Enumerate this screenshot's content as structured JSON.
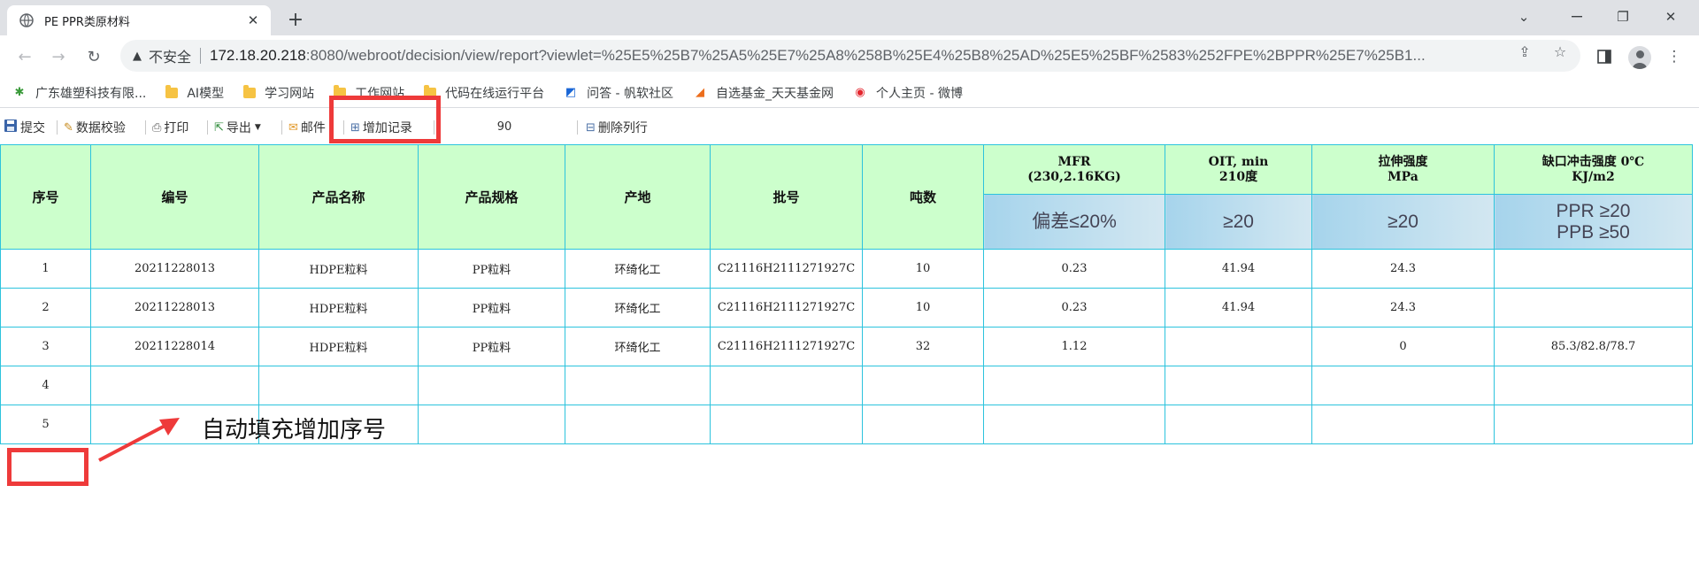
{
  "browser": {
    "tab_title": "PE PPR类原材料",
    "tab_close": "✕",
    "new_tab": "+",
    "window_controls": {
      "minimize": "⌄",
      "restore": "❐",
      "close": "✕"
    },
    "security_label": "不安全",
    "url_host": "172.18.20.218",
    "url_rest": ":8080/webroot/decision/view/report?viewlet=%25E5%25B7%25A5%25E7%25A8%258B%25E4%25B8%25AD%25E5%25BF%2583%252FPE%2BPPR%25E7%25B1..."
  },
  "bookmarks": [
    {
      "label": "广东雄塑科技有限...",
      "icon": "puzzle-icon"
    },
    {
      "label": "AI模型",
      "icon": "folder-icon"
    },
    {
      "label": "学习网站",
      "icon": "folder-icon"
    },
    {
      "label": "工作网站",
      "icon": "folder-icon"
    },
    {
      "label": "代码在线运行平台",
      "icon": "folder-icon"
    },
    {
      "label": "问答 - 帆软社区",
      "icon": "fanruan-icon"
    },
    {
      "label": "自选基金_天天基金网",
      "icon": "fund-icon"
    },
    {
      "label": "个人主页 - 微博",
      "icon": "weibo-icon"
    }
  ],
  "report_toolbar": {
    "submit": "提交",
    "validate": "数据校验",
    "print": "打印",
    "export": "导出",
    "mail": "邮件",
    "add_record": "增加记录",
    "page_number": "90",
    "delete_row": "删除列行"
  },
  "table": {
    "headers": {
      "seq": "序号",
      "code": "编号",
      "name": "产品名称",
      "spec": "产品规格",
      "origin": "产地",
      "batch": "批号",
      "tons": "吨数",
      "mfr_line1": "MFR",
      "mfr_line2": "(230,2.16KG)",
      "oit_line1": "OIT, min",
      "oit_line2": "210度",
      "tensile_line1": "拉伸强度",
      "tensile_line2": "MPa",
      "impact_line1": "缺口冲击强度 0℃",
      "impact_line2": "KJ/m2"
    },
    "requirements": {
      "mfr": "偏差≤20%",
      "oit": "≥20",
      "tensile": "≥20",
      "impact_line1": "PPR ≥20",
      "impact_line2": "PPB ≥50"
    },
    "rows": [
      {
        "seq": "1",
        "code": "20211228013",
        "name": "HDPE粒料",
        "spec": "PP粒料",
        "origin": "环绮化工",
        "batch": "C21116H2111271927C",
        "tons": "10",
        "mfr": "0.23",
        "oit": "41.94",
        "tensile": "24.3",
        "impact": ""
      },
      {
        "seq": "2",
        "code": "20211228013",
        "name": "HDPE粒料",
        "spec": "PP粒料",
        "origin": "环绮化工",
        "batch": "C21116H2111271927C",
        "tons": "10",
        "mfr": "0.23",
        "oit": "41.94",
        "tensile": "24.3",
        "impact": ""
      },
      {
        "seq": "3",
        "code": "20211228014",
        "name": "HDPE粒料",
        "spec": "PP粒料",
        "origin": "环绮化工",
        "batch": "C21116H2111271927C",
        "tons": "32",
        "mfr": "1.12",
        "oit": "",
        "tensile": "0",
        "impact": "85.3/82.8/78.7"
      },
      {
        "seq": "4",
        "code": "",
        "name": "",
        "spec": "",
        "origin": "",
        "batch": "",
        "tons": "",
        "mfr": "",
        "oit": "",
        "tensile": "",
        "impact": ""
      },
      {
        "seq": "5",
        "code": "",
        "name": "",
        "spec": "",
        "origin": "",
        "batch": "",
        "tons": "",
        "mfr": "",
        "oit": "",
        "tensile": "",
        "impact": ""
      }
    ]
  },
  "annotation": {
    "text": "自动填充增加序号",
    "color": "#ee3a3a"
  },
  "colors": {
    "header_bg": "#ccffcc",
    "grid_border": "#2cc3dd",
    "requirement_bg": "#a6d4ec"
  }
}
